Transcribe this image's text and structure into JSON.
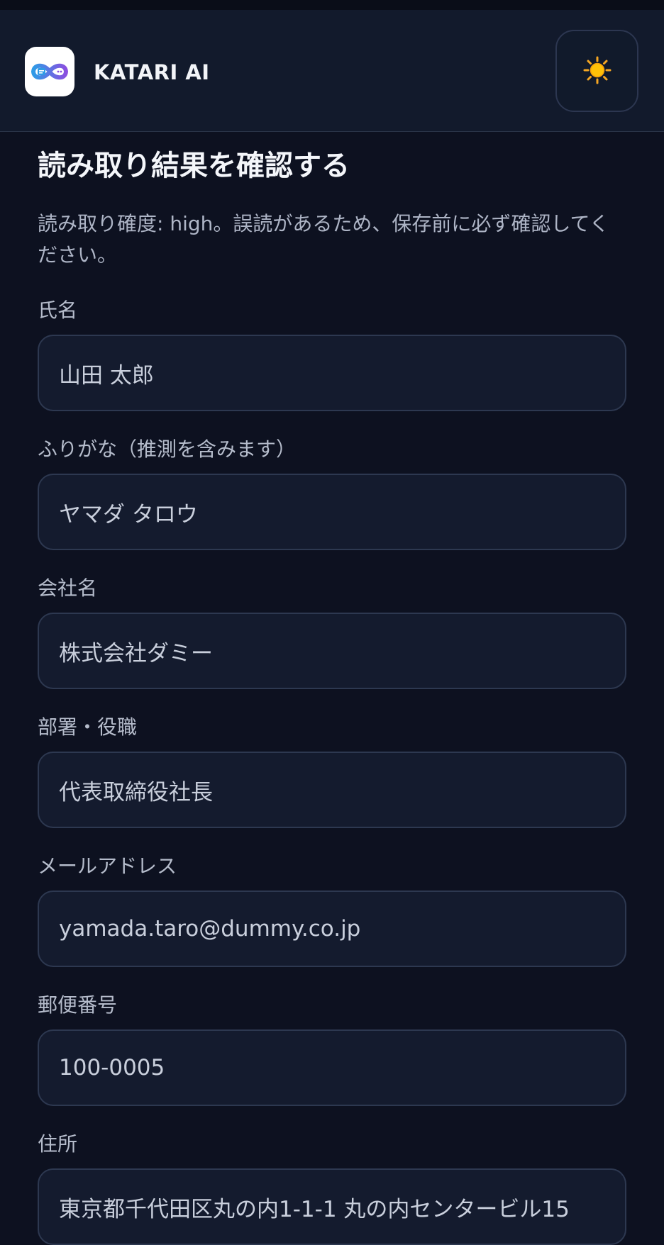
{
  "header": {
    "app_title": "KATARI AI",
    "logo_icon": "infinity-logo-icon",
    "theme_toggle_icon": "sun-icon"
  },
  "main": {
    "title": "読み取り結果を確認する",
    "notice": "読み取り確度: high。誤読があるため、保存前に必ず確認してください。",
    "fields": [
      {
        "label": "氏名",
        "value": "山田 太郎"
      },
      {
        "label": "ふりがな（推測を含みます）",
        "value": "ヤマダ タロウ"
      },
      {
        "label": "会社名",
        "value": "株式会社ダミー"
      },
      {
        "label": "部署・役職",
        "value": "代表取締役社長"
      },
      {
        "label": "メールアドレス",
        "value": "yamada.taro@dummy.co.jp"
      },
      {
        "label": "郵便番号",
        "value": "100-0005"
      },
      {
        "label": "住所",
        "value": "東京都千代田区丸の内1-1-1 丸の内センタービル15"
      }
    ]
  },
  "colors": {
    "background": "#0d1120",
    "header_bg": "#121a2c",
    "input_bg": "#141b2e",
    "input_border": "#2d3850",
    "logo_accent": "#3b8fe0",
    "logo_accent2": "#8a4fe0"
  }
}
